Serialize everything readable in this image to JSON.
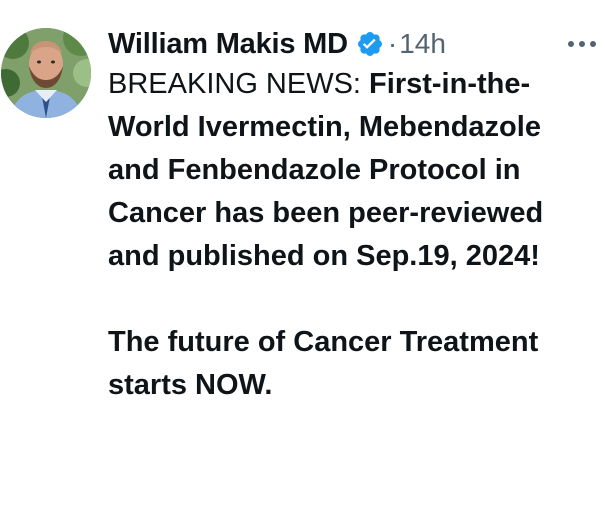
{
  "tweet": {
    "author": {
      "display_name": "William Makis MD",
      "verified_icon": "verified-badge-icon"
    },
    "separator": "·",
    "time": "14h",
    "more_icon": "more-options-icon",
    "body": {
      "prefix": "BREAKING NEWS: ",
      "headline": "First-in-the-World Ivermectin, Mebendazole and Fenbendazole Protocol in Cancer has been peer-reviewed and published on Sep.19, 2024!",
      "closing": "The future of Cancer Treatment starts NOW."
    }
  },
  "colors": {
    "text": "#0f1419",
    "muted": "#536471",
    "verified": "#1d9bf0"
  }
}
